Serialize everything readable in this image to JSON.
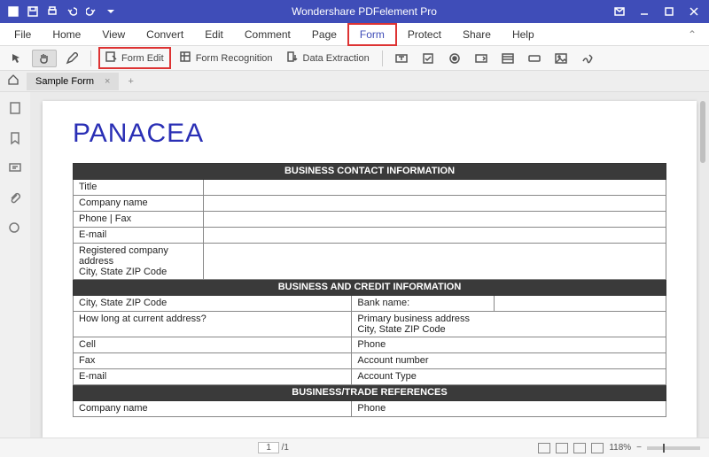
{
  "app": {
    "title": "Wondershare PDFelement Pro"
  },
  "menu": {
    "items": [
      "File",
      "Home",
      "View",
      "Convert",
      "Edit",
      "Comment",
      "Page",
      "Form",
      "Protect",
      "Share",
      "Help"
    ],
    "highlighted": "Form"
  },
  "toolbar": {
    "form_edit": "Form Edit",
    "form_recognition": "Form Recognition",
    "data_extraction": "Data Extraction"
  },
  "tab": {
    "name": "Sample Form",
    "close": "×",
    "add": "+"
  },
  "doc": {
    "heading": "PANACEA",
    "section1": "BUSINESS CONTACT INFORMATION",
    "s1": {
      "r1": "Title",
      "r2": "Company name",
      "r3": "Phone | Fax",
      "r4": "E-mail",
      "r5": "Registered company address\nCity, State ZIP Code"
    },
    "section2": "BUSINESS AND CREDIT INFORMATION",
    "s2": {
      "r1a": "City, State ZIP Code",
      "r1b": "Bank name:",
      "r2a": "How long at current address?",
      "r2b": "Primary business address\nCity, State ZIP Code",
      "r3a": "Cell",
      "r3b": "Phone",
      "r4a": "Fax",
      "r4b": "Account number",
      "r5a": "E-mail",
      "r5b": "Account Type"
    },
    "section3": "BUSINESS/TRADE REFERENCES",
    "s3": {
      "r1a": "Company name",
      "r1b": "Phone"
    }
  },
  "status": {
    "page_cur": "1",
    "page_sep": "/1",
    "zoom": "118%",
    "minus": "−"
  }
}
